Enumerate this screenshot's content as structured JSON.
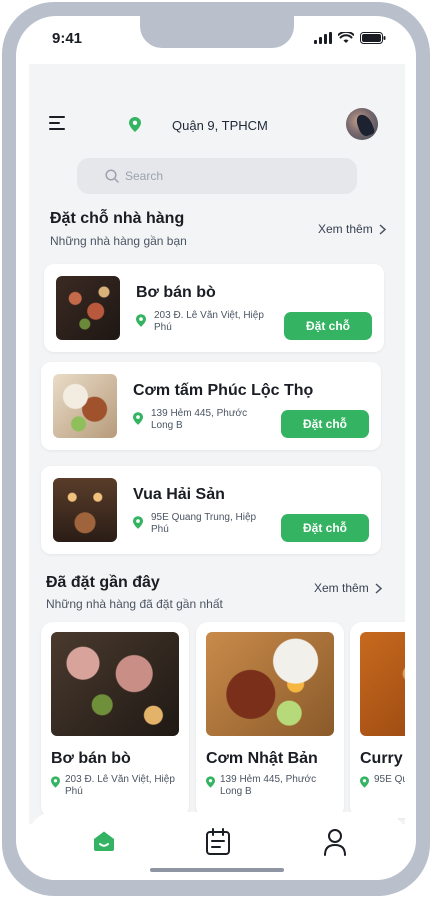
{
  "status_bar": {
    "time": "9:41"
  },
  "header": {
    "location": "Quận 9, TPHCM"
  },
  "search": {
    "placeholder": "Search"
  },
  "reservations": {
    "title": "Đặt chỗ nhà hàng",
    "subtitle": "Những nhà hàng gần bạn",
    "see_more": "Xem thêm",
    "items": [
      {
        "name": "Bơ bán bò",
        "address": "203 Đ. Lê Văn Việt, Hiệp Phú",
        "button": "Đặt chỗ"
      },
      {
        "name": "Cơm tấm Phúc Lộc Thọ",
        "address": "139 Hẻm 445, Phước Long B",
        "button": "Đặt chỗ"
      },
      {
        "name": "Vua Hải Sản",
        "address": "95E Quang Trung, Hiệp Phú",
        "button": "Đặt chỗ"
      }
    ]
  },
  "recent": {
    "title": "Đã đặt gần đây",
    "subtitle": "Những nhà hàng đã đặt gần nhất",
    "see_more": "Xem thêm",
    "items": [
      {
        "name": "Bơ bán bò",
        "address": "203 Đ. Lê Văn Việt, Hiệp Phú"
      },
      {
        "name": "Cơm Nhật Bản",
        "address": "139 Hẻm 445, Phước Long B"
      },
      {
        "name": "Curry",
        "address": "95E Qu"
      }
    ]
  },
  "bottom_nav": {
    "items": [
      "home-icon",
      "calendar-icon",
      "profile-icon"
    ]
  },
  "colors": {
    "accent": "#34b463",
    "text": "#1a1d24",
    "muted": "#4b5563",
    "background": "#f3f4f6"
  }
}
